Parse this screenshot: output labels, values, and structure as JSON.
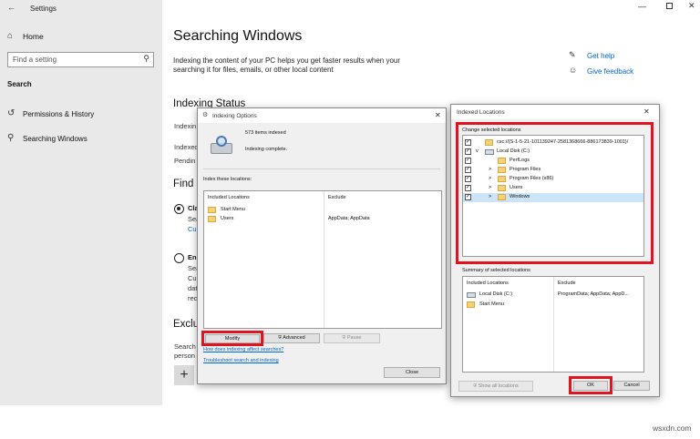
{
  "settings": {
    "window_title": "Settings",
    "home_label": "Home",
    "search_placeholder": "Find a setting",
    "section_label": "Search",
    "nav_items": [
      "Permissions & History",
      "Searching Windows"
    ],
    "page_title": "Searching Windows",
    "description": "Indexing the content of your PC helps you get faster results when your searching it for files, emails, or other local content",
    "indexing_status_title": "Indexing Status",
    "partial_labels": [
      "Indexin",
      "Indexed",
      "Pendin"
    ],
    "find_title": "Find I",
    "option1_partial": [
      "Cla",
      "Sea",
      "Cu"
    ],
    "option2_partial": [
      "En",
      "Sea",
      "Cu",
      "dat",
      "rec"
    ],
    "exclude_title": "Exclu",
    "exclude_partial": [
      "Search",
      "person"
    ],
    "help_links": [
      "Get help",
      "Give feedback"
    ]
  },
  "indexing_options": {
    "title": "Indexing Options",
    "items_indexed": "573 items indexed",
    "status": "Indexing complete.",
    "index_these_label": "Index these locations:",
    "col_included": "Included Locations",
    "col_exclude": "Exclude",
    "rows": [
      {
        "location": "Start Menu",
        "exclude": ""
      },
      {
        "location": "Users",
        "exclude": "AppData; AppData"
      }
    ],
    "modify_label": "Modify",
    "advanced_label": "Advanced",
    "pause_label": "Pause",
    "link1": "How does indexing affect searches?",
    "link2": "Troubleshoot search and indexing",
    "close_label": "Close"
  },
  "indexed_locations": {
    "title": "Indexed Locations",
    "change_label": "Change selected locations",
    "tree": [
      {
        "label": "csc://{S-1-5-21-101139247-2581368666-886173839-1001}/",
        "checked": true,
        "expander": "",
        "icon": "folder-icon"
      },
      {
        "label": "Local Disk (C:)",
        "checked": true,
        "expander": "v",
        "icon": "drive-icon"
      },
      {
        "label": "PerfLogs",
        "checked": true,
        "expander": "",
        "icon": "folder-icon"
      },
      {
        "label": "Program Files",
        "checked": true,
        "expander": ">",
        "icon": "folder-icon"
      },
      {
        "label": "Program Files (x86)",
        "checked": true,
        "expander": ">",
        "icon": "folder-icon"
      },
      {
        "label": "Users",
        "checked": true,
        "expander": ">",
        "icon": "folder-icon"
      },
      {
        "label": "Windows",
        "checked": true,
        "expander": ">",
        "icon": "folder-icon"
      }
    ],
    "summary_label": "Summary of selected locations",
    "sum_col_included": "Included Locations",
    "sum_col_exclude": "Exclude",
    "summary_rows": [
      {
        "location": "Local Disk (C:)",
        "exclude": "ProgramData; AppData; AppD..."
      },
      {
        "location": "Start Menu",
        "exclude": ""
      }
    ],
    "show_all_label": "Show all locations",
    "ok_label": "OK",
    "cancel_label": "Cancel"
  },
  "watermark": "wsxdn.com",
  "colors": {
    "highlight_frame": "#e0141e",
    "link": "#0066cc",
    "accent": "#0078d7"
  }
}
